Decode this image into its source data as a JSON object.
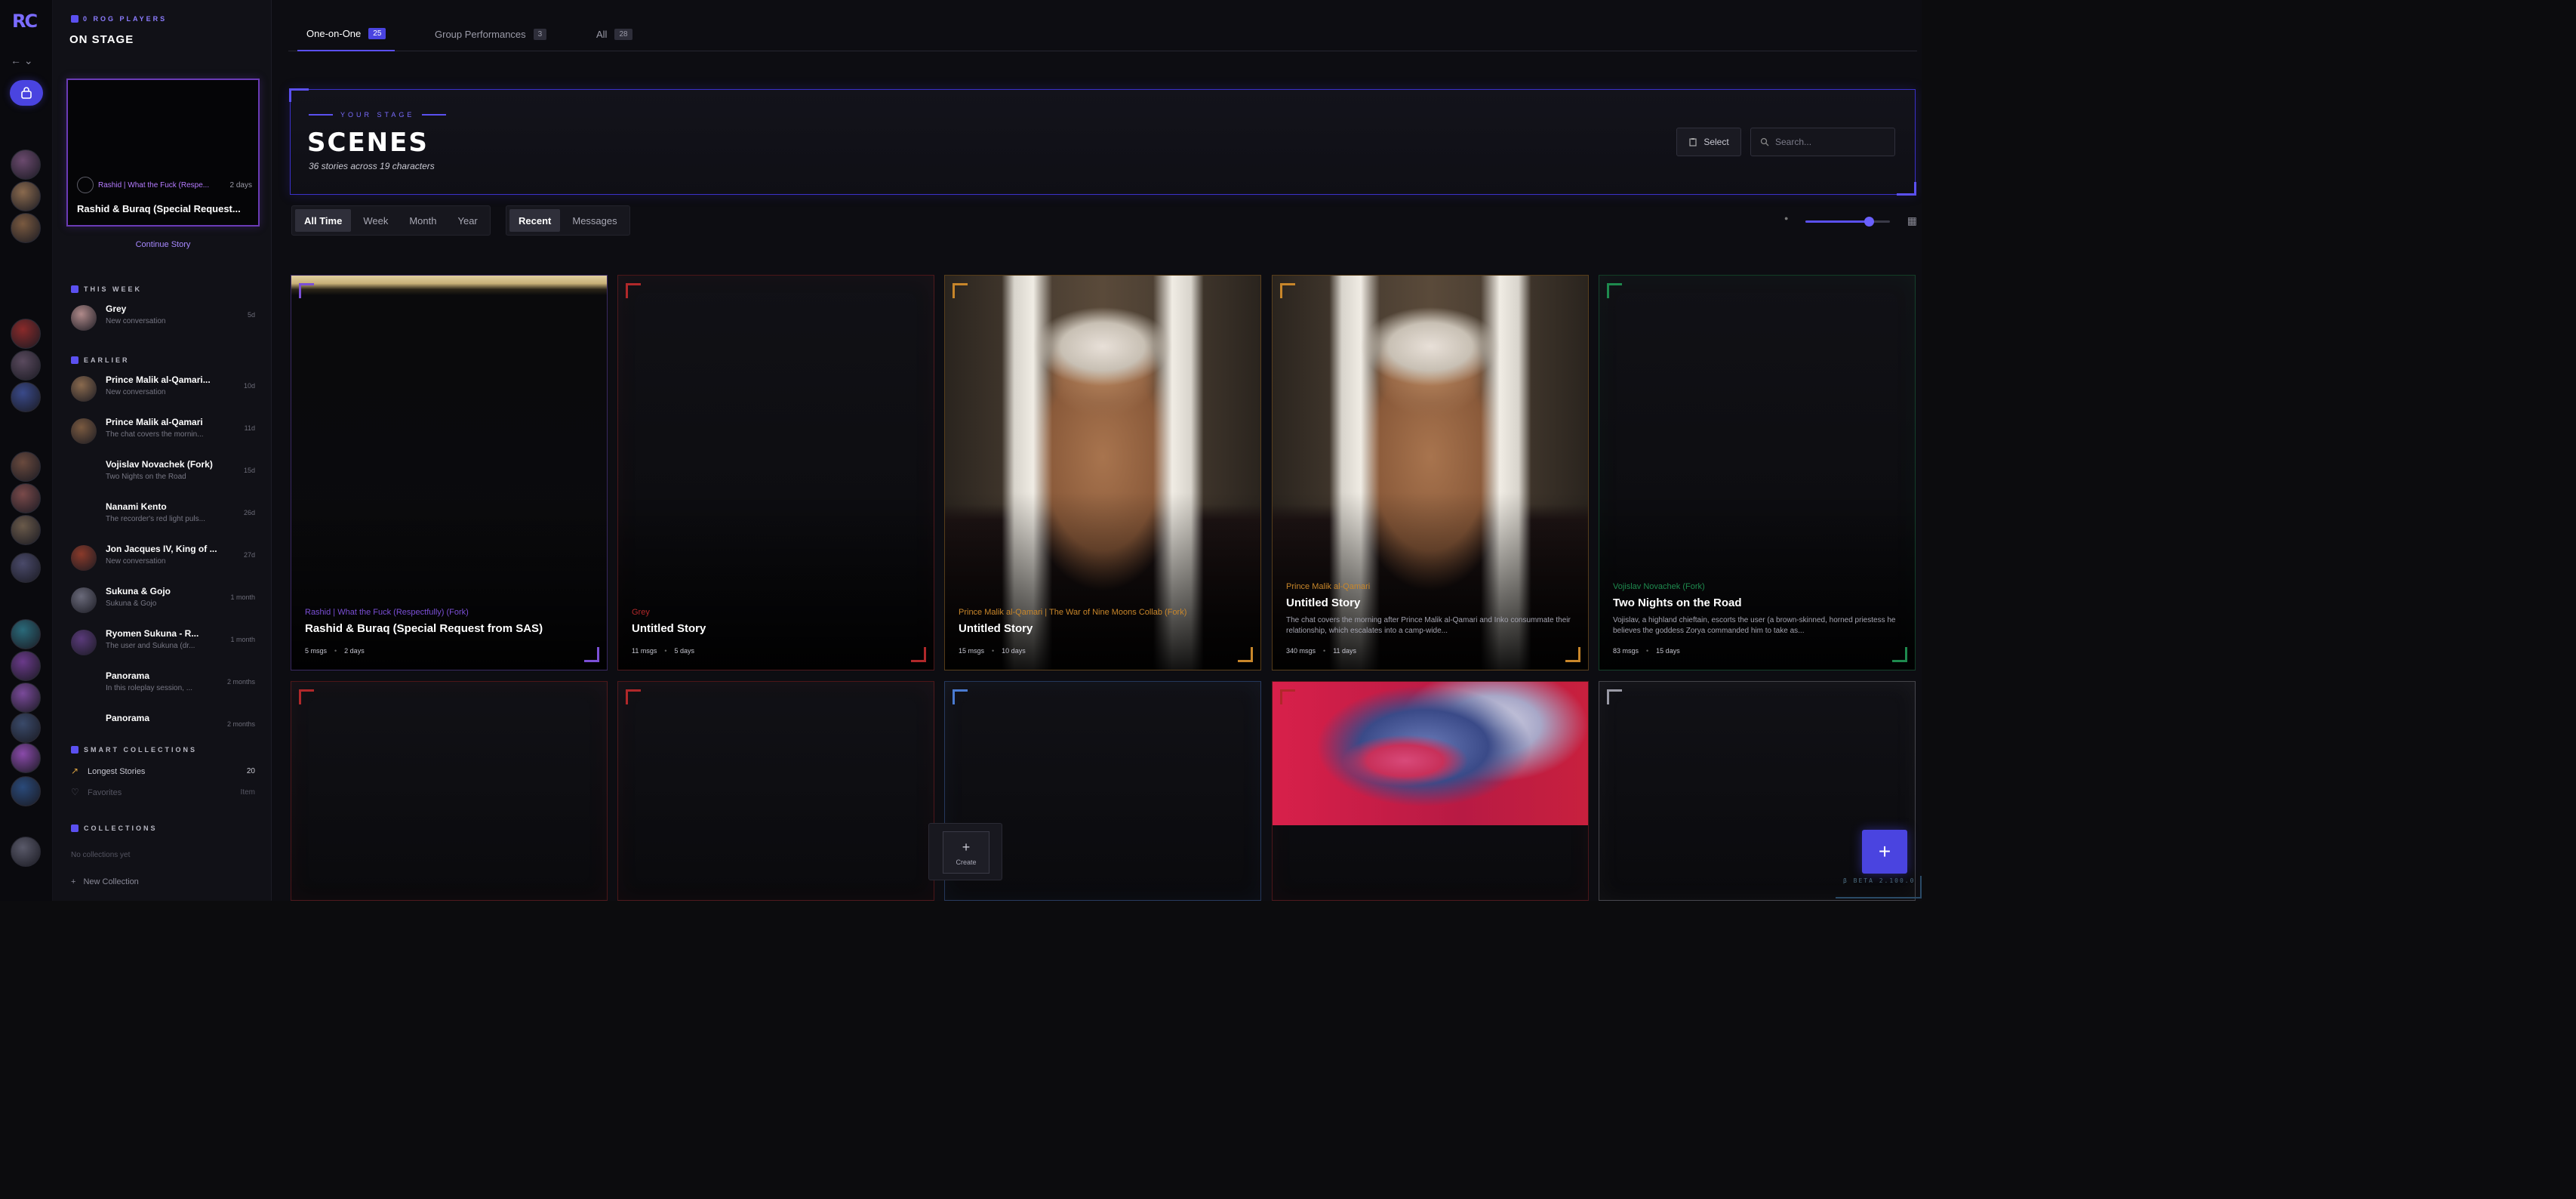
{
  "brand": {
    "logo": "RC",
    "accent": "#5b50f0",
    "bg": "#0c0c0e"
  },
  "rail": {
    "nav": "← ⌄",
    "avatars": [
      {
        "color": "#6b4a6e"
      },
      {
        "color": "#8a6a4e"
      },
      {
        "color": "#7a5a40"
      },
      {
        "color": "#8a2a2a"
      },
      {
        "color": "#5a4a5e"
      },
      {
        "color": "#3a4a8a"
      },
      {
        "color": "#6a4a3e"
      },
      {
        "color": "#7a4a4a"
      },
      {
        "color": "#6a5a4a"
      },
      {
        "color": "#4a4a6a"
      },
      {
        "color": "#2a6a7a"
      },
      {
        "color": "#6a3a8a"
      },
      {
        "color": "#7a4a9a"
      },
      {
        "color": "#3a4a6a"
      },
      {
        "color": "#8a4aaa"
      },
      {
        "color": "#2a4a7a"
      },
      {
        "color": "#5a5a6a"
      }
    ]
  },
  "sidebar": {
    "eyebrow": "0 ROG PLAYERS",
    "title": "ON STAGE",
    "hero": {
      "character": "Rashid | What the Fuck (Respe...",
      "age": "2 days",
      "title": "Rashid & Buraq (Special Request..."
    },
    "continue_label": "Continue Story",
    "this_week_label": "THIS WEEK",
    "earlier_label": "EARLIER",
    "this_week": [
      {
        "name": "Grey",
        "sub": "New conversation",
        "age": "5d",
        "color": "#b08a8a"
      }
    ],
    "earlier": [
      {
        "name": "Prince Malik al-Qamari...",
        "sub": "New conversation",
        "age": "10d",
        "color": "#8a6a4e"
      },
      {
        "name": "Prince Malik al-Qamari",
        "sub": "The chat covers the mornin...",
        "age": "11d",
        "color": "#7a5a40"
      },
      {
        "name": "Vojislav Novachek (Fork)",
        "sub": "Two Nights on the Road",
        "age": "15d",
        "color": ""
      },
      {
        "name": "Nanami Kento",
        "sub": "The recorder's red light puls...",
        "age": "26d",
        "color": ""
      },
      {
        "name": "Jon Jacques IV, King of ...",
        "sub": "New conversation",
        "age": "27d",
        "color": "#8a3a2a"
      },
      {
        "name": "Sukuna & Gojo",
        "sub": "Sukuna & Gojo",
        "age": "1 month",
        "color": "#6a6a7a"
      },
      {
        "name": "Ryomen Sukuna - R...",
        "sub": "The user and Sukuna (dr...",
        "age": "1 month",
        "color": "#5a3a7a"
      },
      {
        "name": "Panorama",
        "sub": "In this roleplay session, ...",
        "age": "2 months",
        "color": ""
      },
      {
        "name": "Panorama",
        "sub": "",
        "age": "2 months",
        "color": ""
      }
    ],
    "smart_label": "SMART COLLECTIONS",
    "smart": [
      {
        "label": "Longest Stories",
        "count": "20",
        "icon": "↗"
      },
      {
        "label": "Favorites",
        "count": "Item",
        "icon": "♡"
      }
    ],
    "collections_label": "COLLECTIONS",
    "no_collections": "No collections yet",
    "new_collection": "New Collection"
  },
  "tabs": [
    {
      "label": "One-on-One",
      "count": "25",
      "active": true
    },
    {
      "label": "Group Performances",
      "count": "3",
      "active": false
    },
    {
      "label": "All",
      "count": "28",
      "active": false
    }
  ],
  "banner": {
    "eyebrow": "YOUR STAGE",
    "title": "SCENES",
    "subtitle": "36 stories across 19 characters",
    "select_label": "Select",
    "search_placeholder": "Search..."
  },
  "time_filters": [
    {
      "label": "All Time",
      "on": true
    },
    {
      "label": "Week",
      "on": false
    },
    {
      "label": "Month",
      "on": false
    },
    {
      "label": "Year",
      "on": false
    }
  ],
  "sort_filters": [
    {
      "label": "Recent",
      "on": true
    },
    {
      "label": "Messages",
      "on": false
    }
  ],
  "zoom": {
    "value": 0.75
  },
  "cards": [
    {
      "character": "Rashid | What the Fuck (Respectfully) (Fork)",
      "title": "Rashid & Buraq (Special Request from SAS)",
      "desc": "",
      "msgs": "5 msgs",
      "age": "2 days",
      "accent": "#7b4fd6",
      "art": "banner"
    },
    {
      "character": "Grey",
      "title": "Untitled Story",
      "desc": "",
      "msgs": "11 msgs",
      "age": "5 days",
      "accent": "#b0282a",
      "art": ""
    },
    {
      "character": "Prince Malik al-Qamari | The War of Nine Moons Collab (Fork)",
      "title": "Untitled Story",
      "desc": "",
      "msgs": "15 msgs",
      "age": "10 days",
      "accent": "#c8862a",
      "art": "portrait"
    },
    {
      "character": "Prince Malik al-Qamari",
      "title": "Untitled Story",
      "desc": "The chat covers the morning after Prince Malik al-Qamari and Inko consummate their relationship, which escalates into a camp-wide...",
      "msgs": "340 msgs",
      "age": "11 days",
      "accent": "#c8862a",
      "art": "portrait"
    },
    {
      "character": "Vojislav Novachek (Fork)",
      "title": "Two Nights on the Road",
      "desc": "Vojislav, a highland chieftain, escorts the user (a brown-skinned, horned priestess he believes the goddess Zorya commanded him to take as...",
      "msgs": "83 msgs",
      "age": "15 days",
      "accent": "#1e8a4e",
      "art": ""
    },
    {
      "character": "",
      "title": "",
      "desc": "",
      "msgs": "",
      "age": "",
      "accent": "#b0282a",
      "art": ""
    },
    {
      "character": "",
      "title": "",
      "desc": "",
      "msgs": "",
      "age": "",
      "accent": "#b0282a",
      "art": ""
    },
    {
      "character": "",
      "title": "",
      "desc": "",
      "msgs": "",
      "age": "",
      "accent": "#4a7ad0",
      "art": ""
    },
    {
      "character": "",
      "title": "",
      "desc": "",
      "msgs": "",
      "age": "",
      "accent": "#b0282a",
      "art": "anime"
    },
    {
      "character": "",
      "title": "",
      "desc": "",
      "msgs": "",
      "age": "",
      "accent": "#9a9aa6",
      "art": ""
    }
  ],
  "create_label": "Create",
  "fab_label": "+",
  "beta_label": "β BETA 2.100.0"
}
